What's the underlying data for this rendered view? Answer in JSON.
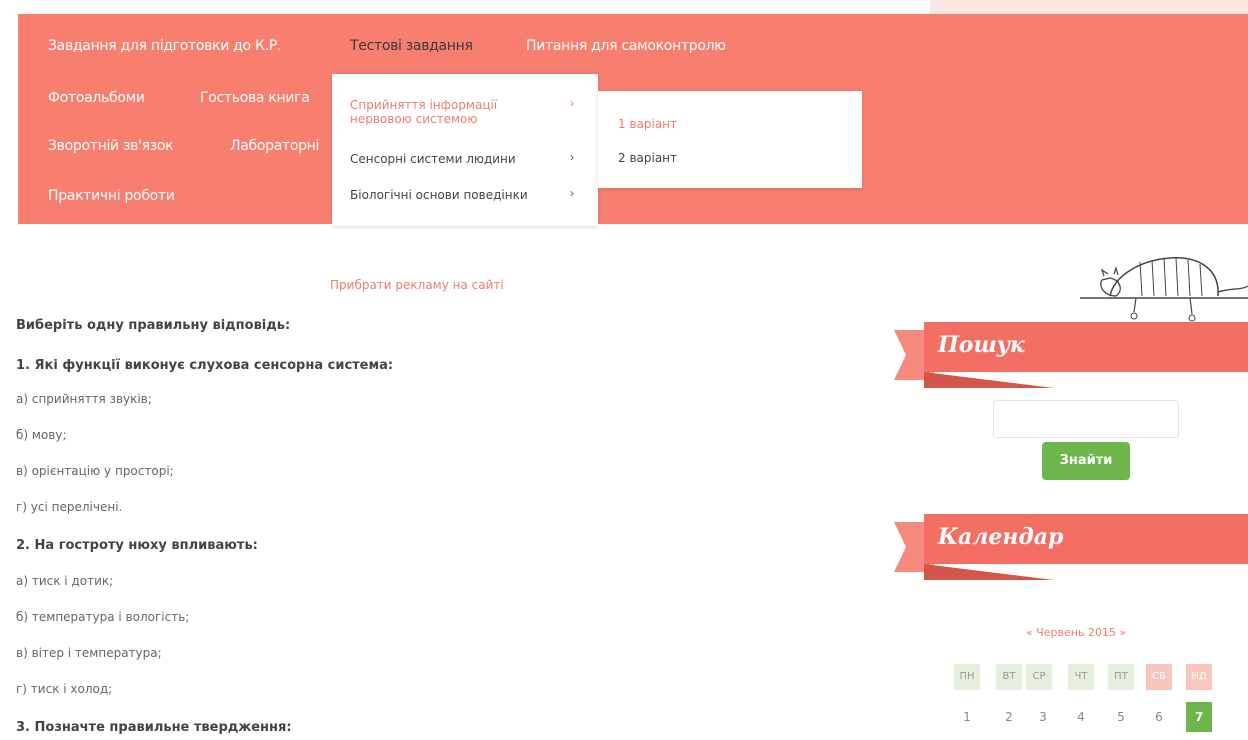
{
  "nav": {
    "items": [
      "Завдання для підготовки до К.Р.",
      "Тестові завдання",
      "Питання для самоконтролю",
      "Фотоальбоми",
      "Гостьова книга",
      "Зворотній зв'язок",
      "Лабораторні",
      "Практичні роботи"
    ]
  },
  "dropdown": {
    "items": [
      {
        "label_line1": "Сприйняття інформації",
        "label_line2": "нервовою системою",
        "arrow": "›"
      },
      {
        "label": "Сенсорні системи людини",
        "arrow": "›"
      },
      {
        "label": "Біологічні основи поведінки",
        "arrow": "›"
      }
    ],
    "submenu": [
      "1 варіант",
      "2 варіант"
    ]
  },
  "main": {
    "ad_link": "Прибрати рекламу на сайті",
    "lines": [
      {
        "text": "Виберіть одну правильну відповідь:",
        "bold": true
      },
      {
        "text": "1. Які функції виконує слухова сенсорна система:",
        "bold": true
      },
      {
        "text": "а) сприйняття звуків;",
        "bold": false
      },
      {
        "text": "б) мову;",
        "bold": false
      },
      {
        "text": "в) орієнтацію у просторі;",
        "bold": false
      },
      {
        "text": "г) усі перелічені.",
        "bold": false
      },
      {
        "text": "2. На гостроту нюху впливають:",
        "bold": true
      },
      {
        "text": "а) тиск і дотик;",
        "bold": false
      },
      {
        "text": "б) температура і вологість;",
        "bold": false
      },
      {
        "text": "в) вітер і температура;",
        "bold": false
      },
      {
        "text": "г) тиск і холод;",
        "bold": false
      },
      {
        "text": "3. Позначте правильне твердження:",
        "bold": true
      }
    ]
  },
  "sidebar": {
    "search_title": "Пошук",
    "search_button": "Знайти",
    "calendar_title": "Календар",
    "month_nav": "« Червень 2015 »",
    "weekdays": [
      "ПН",
      "ВТ",
      "СР",
      "ЧТ",
      "ПТ",
      "СБ",
      "НД"
    ],
    "days": [
      "1",
      "2",
      "3",
      "4",
      "5",
      "6",
      "7"
    ]
  },
  "colors": {
    "nav_bg": "#f87e70",
    "accent": "#f07c6e",
    "button_green": "#6cb64c",
    "ribbon": "#f36f63"
  }
}
